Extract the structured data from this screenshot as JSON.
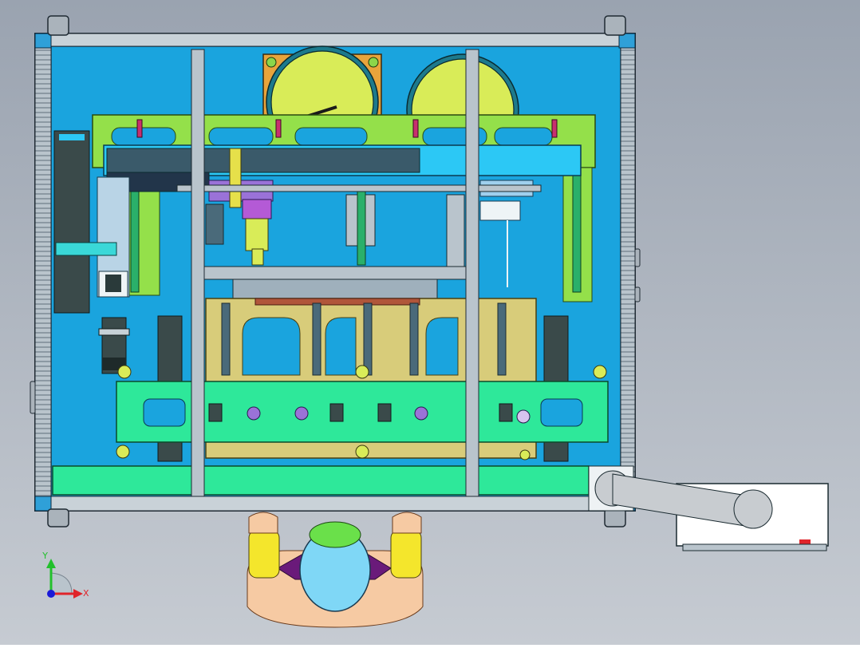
{
  "viewport": {
    "background_top": "#9aa3b0",
    "background_bottom": "#c6cbd2"
  },
  "axis_triad": {
    "x_label": "X",
    "y_label": "Y",
    "x_color": "#e0242a",
    "y_color": "#22c02c",
    "z_color": "#1a1ad8"
  },
  "colors": {
    "frame_profile": "#b9c4cc",
    "enclosure_panel": "#1aa4de",
    "top_gantry": "#94e04a",
    "guard_cover": "#2cc8f5",
    "fixture_bridge": "#2ee89a",
    "fixture_base": "#d8cc7a",
    "servo_motor": "#3a4a4a",
    "tape_reel": "#d9ec58",
    "operator_skin": "#f6caa3",
    "operator_helmet": "#7fd7f6",
    "operator_sleeve": "#f4e62c",
    "foot_pedal_housing": "#ffffff"
  }
}
